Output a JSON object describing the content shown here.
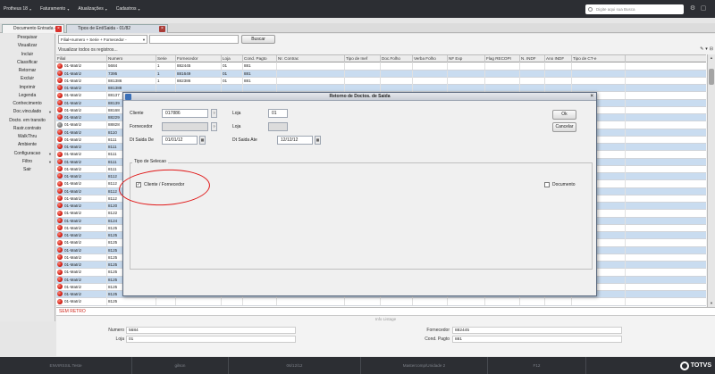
{
  "topbar": {
    "menus": [
      "Protheus 18",
      "Faturamento",
      "Atualizações",
      "Cadastros"
    ],
    "search_placeholder": "Digite aqui sua Busca"
  },
  "tabs": [
    {
      "label": "Documento Entrada - 01/82",
      "active": true
    },
    {
      "label": "Tipos de Ent/Saida - 01/82",
      "active": false
    }
  ],
  "sidebar": {
    "items": [
      {
        "label": "Pesquisar",
        "arrow": false
      },
      {
        "label": "Visualizar",
        "arrow": false
      },
      {
        "label": "Incluir",
        "arrow": false
      },
      {
        "label": "Classificar",
        "arrow": false
      },
      {
        "label": "Retornar",
        "arrow": false
      },
      {
        "label": "Excluir",
        "arrow": false
      },
      {
        "label": "Imprimir",
        "arrow": false
      },
      {
        "label": "Legenda",
        "arrow": false
      },
      {
        "label": "Conhecimento",
        "arrow": false
      },
      {
        "label": "Doc.vinculado",
        "arrow": true
      },
      {
        "label": "Docto. em transito",
        "arrow": false
      },
      {
        "label": "Rastr.contrato",
        "arrow": false
      },
      {
        "label": "WalkThru",
        "arrow": false
      },
      {
        "label": "Ambiente",
        "arrow": false
      },
      {
        "label": "Configuracao",
        "arrow": true
      },
      {
        "label": "Filtro",
        "arrow": true
      },
      {
        "label": "Sair",
        "arrow": false
      }
    ]
  },
  "filterbar": {
    "index": "Filial+numero + Serie + Fornecedor -",
    "search_value": "",
    "button": "Buscar"
  },
  "visualizar_label": "Visualizar todos os registros...",
  "grid": {
    "columns": [
      "Filial",
      "Numero",
      "Serie",
      "Fornecedor",
      "Loja",
      "Cond. Pagto",
      "Nr. Contrac",
      "Tipo de Inef",
      "Doc.Folho",
      "Verba Folho",
      "NF Exp",
      "Flag RECOPI",
      "N. INDF",
      "Ano INDF",
      "Tipo de CT-e"
    ],
    "rows": [
      {
        "filial": "01-Matriz",
        "numero": "5684",
        "serie": "1",
        "fornecedor": "882445",
        "loja": "01",
        "cond": "881",
        "led": "red"
      },
      {
        "filial": "01-Matriz",
        "numero": "7395",
        "serie": "1",
        "fornecedor": "881649",
        "loja": "01",
        "cond": "881",
        "led": "red"
      },
      {
        "filial": "01-Matriz",
        "numero": "881386",
        "serie": "1",
        "fornecedor": "882386",
        "loja": "01",
        "cond": "881",
        "led": "red"
      },
      {
        "filial": "01-Matriz",
        "numero": "881388",
        "serie": "",
        "fornecedor": "",
        "loja": "",
        "cond": "",
        "led": "red"
      },
      {
        "filial": "01-Matriz",
        "numero": "88137",
        "serie": "",
        "fornecedor": "",
        "loja": "",
        "cond": "",
        "led": "red"
      },
      {
        "filial": "01-Matriz",
        "numero": "88139",
        "serie": "",
        "fornecedor": "",
        "loja": "",
        "cond": "",
        "led": "red"
      },
      {
        "filial": "01-Matriz",
        "numero": "88168",
        "serie": "",
        "fornecedor": "",
        "loja": "",
        "cond": "",
        "led": "red"
      },
      {
        "filial": "01-Matriz",
        "numero": "88229",
        "serie": "",
        "fornecedor": "",
        "loja": "",
        "cond": "",
        "led": "red"
      },
      {
        "filial": "01-Matriz",
        "numero": "88828",
        "serie": "",
        "fornecedor": "",
        "loja": "",
        "cond": "",
        "led": "gray"
      },
      {
        "filial": "01-Matriz",
        "numero": "8110",
        "serie": "",
        "fornecedor": "",
        "loja": "",
        "cond": "",
        "led": "red"
      },
      {
        "filial": "01-Matriz",
        "numero": "8111",
        "serie": "",
        "fornecedor": "",
        "loja": "",
        "cond": "",
        "led": "red"
      },
      {
        "filial": "01-Matriz",
        "numero": "8111",
        "serie": "",
        "fornecedor": "",
        "loja": "",
        "cond": "",
        "led": "red"
      },
      {
        "filial": "01-Matriz",
        "numero": "8111",
        "serie": "",
        "fornecedor": "",
        "loja": "",
        "cond": "",
        "led": "red"
      },
      {
        "filial": "01-Matriz",
        "numero": "8111",
        "serie": "",
        "fornecedor": "",
        "loja": "",
        "cond": "",
        "led": "red"
      },
      {
        "filial": "01-Matriz",
        "numero": "8111",
        "serie": "",
        "fornecedor": "",
        "loja": "",
        "cond": "",
        "led": "red"
      },
      {
        "filial": "01-Matriz",
        "numero": "8112",
        "serie": "",
        "fornecedor": "",
        "loja": "",
        "cond": "",
        "led": "red"
      },
      {
        "filial": "01-Matriz",
        "numero": "8112",
        "serie": "",
        "fornecedor": "",
        "loja": "",
        "cond": "",
        "led": "red"
      },
      {
        "filial": "01-Matriz",
        "numero": "8112",
        "serie": "",
        "fornecedor": "",
        "loja": "",
        "cond": "",
        "led": "red"
      },
      {
        "filial": "01-Matriz",
        "numero": "8112",
        "serie": "",
        "fornecedor": "",
        "loja": "",
        "cond": "",
        "led": "red"
      },
      {
        "filial": "01-Matriz",
        "numero": "8120",
        "serie": "",
        "fornecedor": "",
        "loja": "",
        "cond": "",
        "led": "red"
      },
      {
        "filial": "01-Matriz",
        "numero": "8122",
        "serie": "",
        "fornecedor": "",
        "loja": "",
        "cond": "",
        "led": "red"
      },
      {
        "filial": "01-Matriz",
        "numero": "8124",
        "serie": "",
        "fornecedor": "",
        "loja": "",
        "cond": "",
        "led": "red"
      },
      {
        "filial": "01-Matriz",
        "numero": "8125",
        "serie": "",
        "fornecedor": "",
        "loja": "",
        "cond": "",
        "led": "red"
      },
      {
        "filial": "01-Matriz",
        "numero": "8125",
        "serie": "",
        "fornecedor": "",
        "loja": "",
        "cond": "",
        "led": "red"
      },
      {
        "filial": "01-Matriz",
        "numero": "8125",
        "serie": "",
        "fornecedor": "",
        "loja": "",
        "cond": "",
        "led": "red"
      },
      {
        "filial": "01-Matriz",
        "numero": "8125",
        "serie": "",
        "fornecedor": "",
        "loja": "",
        "cond": "",
        "led": "red"
      },
      {
        "filial": "01-Matriz",
        "numero": "8125",
        "serie": "",
        "fornecedor": "",
        "loja": "",
        "cond": "",
        "led": "red"
      },
      {
        "filial": "01-Matriz",
        "numero": "8125",
        "serie": "",
        "fornecedor": "",
        "loja": "",
        "cond": "",
        "led": "red"
      },
      {
        "filial": "01-Matriz",
        "numero": "8125",
        "serie": "",
        "fornecedor": "",
        "loja": "",
        "cond": "",
        "led": "red"
      },
      {
        "filial": "01-Matriz",
        "numero": "8125",
        "serie": "",
        "fornecedor": "",
        "loja": "",
        "cond": "",
        "led": "red"
      },
      {
        "filial": "01-Matriz",
        "numero": "8125",
        "serie": "",
        "fornecedor": "",
        "loja": "",
        "cond": "",
        "led": "red"
      },
      {
        "filial": "01-Matriz",
        "numero": "8125",
        "serie": "",
        "fornecedor": "",
        "loja": "",
        "cond": "",
        "led": "red"
      },
      {
        "filial": "01-Matriz",
        "numero": "8125",
        "serie": "",
        "fornecedor": "",
        "loja": "",
        "cond": "",
        "led": "red"
      }
    ]
  },
  "status_text": "SEM RETRO",
  "details": {
    "title": "Info Listage",
    "numero_label": "Numero",
    "numero_value": "5684",
    "loja_label": "Loja",
    "loja_value": "01",
    "fornecedor_label": "Fornecedor",
    "fornecedor_value": "882445",
    "cond_label": "Cond. Pagto",
    "cond_value": "881"
  },
  "footer": [
    "ENVIRSSIL Teste",
    "gilson",
    "06/12/12",
    "Mastercomp/Unidade 2",
    "F12"
  ],
  "brand": "TOTVS",
  "modal": {
    "title": "Retorno de Doctos. de Saida",
    "cliente_label": "Cliente",
    "cliente_value": "017886",
    "loja_label": "Loja",
    "loja_value": "01",
    "fornecedor_label": "Fornecedor",
    "fornecedor_value": "",
    "loja2_label": "Loja",
    "loja2_value": "",
    "dt_de_label": "Dt Saida De",
    "dt_de_value": "01/01/12",
    "dt_ate_label": "Dt Saida Ate",
    "dt_ate_value": "12/12/12",
    "ok_label": "Ok",
    "cancel_label": "Cancelar",
    "group_title": "Tipo de Selecao",
    "opt1_label": "Cliente / Fornecedor",
    "opt1_checked": true,
    "opt2_label": "Documento",
    "opt2_checked": false
  },
  "colors": {
    "alt_row": "#c9dcf0",
    "led_red": "#d11c12",
    "annotation": "#e01818"
  }
}
